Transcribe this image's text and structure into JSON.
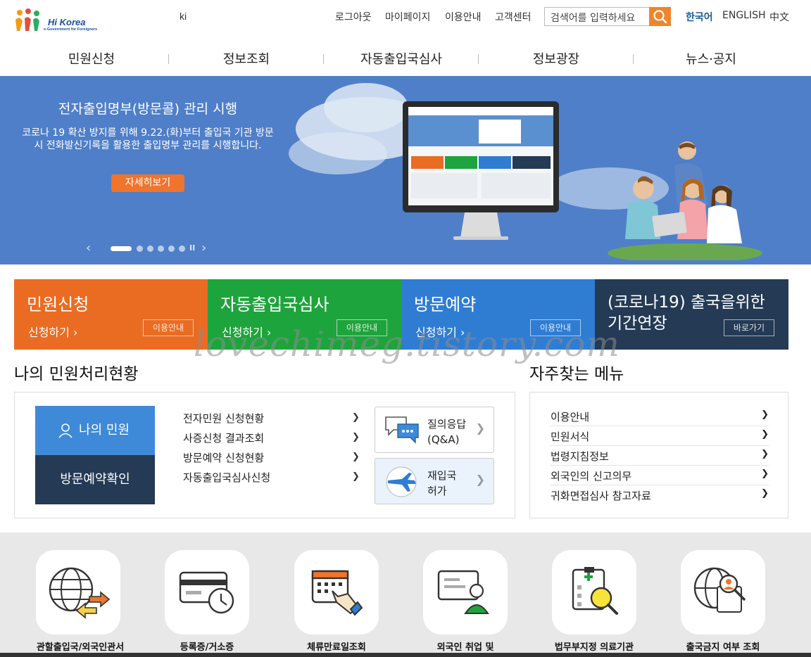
{
  "header": {
    "logo_text": "Hi Korea",
    "logo_sub": "e-Government for Foreigners",
    "ki": "ki",
    "util_links": [
      "로그아웃",
      "마이페이지",
      "이용안내",
      "고객센터"
    ],
    "search_placeholder": "검색어를 입력하세요",
    "languages": [
      "한국어",
      "ENGLISH",
      "中文"
    ]
  },
  "gnb": [
    "민원신청",
    "정보조회",
    "자동출입국심사",
    "정보광장",
    "뉴스·공지"
  ],
  "banner": {
    "title": "전자출입명부(방문콜) 관리 시행",
    "desc": "코로나 19 확산 방지를 위해 9.22.(화)부터 출입국 기관 방문 시 전화발신기록을 활용한 출입명부 관리를 시행합니다.",
    "button": "자세히보기",
    "prev": "‹",
    "next": "›",
    "pause": "II",
    "slide_count": 7,
    "active_slide": 1
  },
  "tiles": [
    {
      "title": "민원신청",
      "link": "신청하기 ›",
      "guide": "이용안내",
      "color": "#ea6c23"
    },
    {
      "title": "자동출입국심사",
      "link": "신청하기 ›",
      "guide": "이용안내",
      "color": "#1ea43c"
    },
    {
      "title": "방문예약",
      "link": "신청하기 ›",
      "guide": "이용안내",
      "color": "#2f7dd3"
    },
    {
      "title": "(코로나19) 출국을위한 기간연장",
      "guide": "바로가기",
      "color": "#243a55"
    }
  ],
  "my_civil": {
    "title": "나의 민원처리현황",
    "my_btn": "나의 민원",
    "visit_btn": "방문예약확인",
    "list": [
      "전자민원 신청현황",
      "사증신청 결과조회",
      "방문예약 신청현황",
      "자동출입국심사신청"
    ],
    "cards": [
      {
        "line1": "질의응답",
        "line2": "(Q&A)"
      },
      {
        "line1": "재입국",
        "line2": "허가"
      }
    ]
  },
  "frequent": {
    "title": "자주찾는 메뉴",
    "items": [
      "이용안내",
      "민원서식",
      "법령지침정보",
      "외국인의 신고의무",
      "귀화면접심사 참고자료"
    ]
  },
  "quick_icons": [
    {
      "label": "관할출입국/외국인관서",
      "icon": "globe-exchange-icon"
    },
    {
      "label": "등록증/거소증",
      "icon": "card-clock-icon"
    },
    {
      "label": "체류만료일조회",
      "icon": "calendar-hand-icon"
    },
    {
      "label": "외국인 취업 및",
      "icon": "employee-screen-icon"
    },
    {
      "label": "법무부지정 의료기관",
      "icon": "medical-search-icon"
    },
    {
      "label": "출국금지 여부 조회",
      "icon": "globe-person-search-icon"
    }
  ],
  "watermark": "lovechimeg.tistory.com",
  "colors": {
    "accent_orange": "#f0842c",
    "nav_dark": "#243a55",
    "banner_blue": "#4f7fc9",
    "brand_blue": "#1a4e9e"
  }
}
